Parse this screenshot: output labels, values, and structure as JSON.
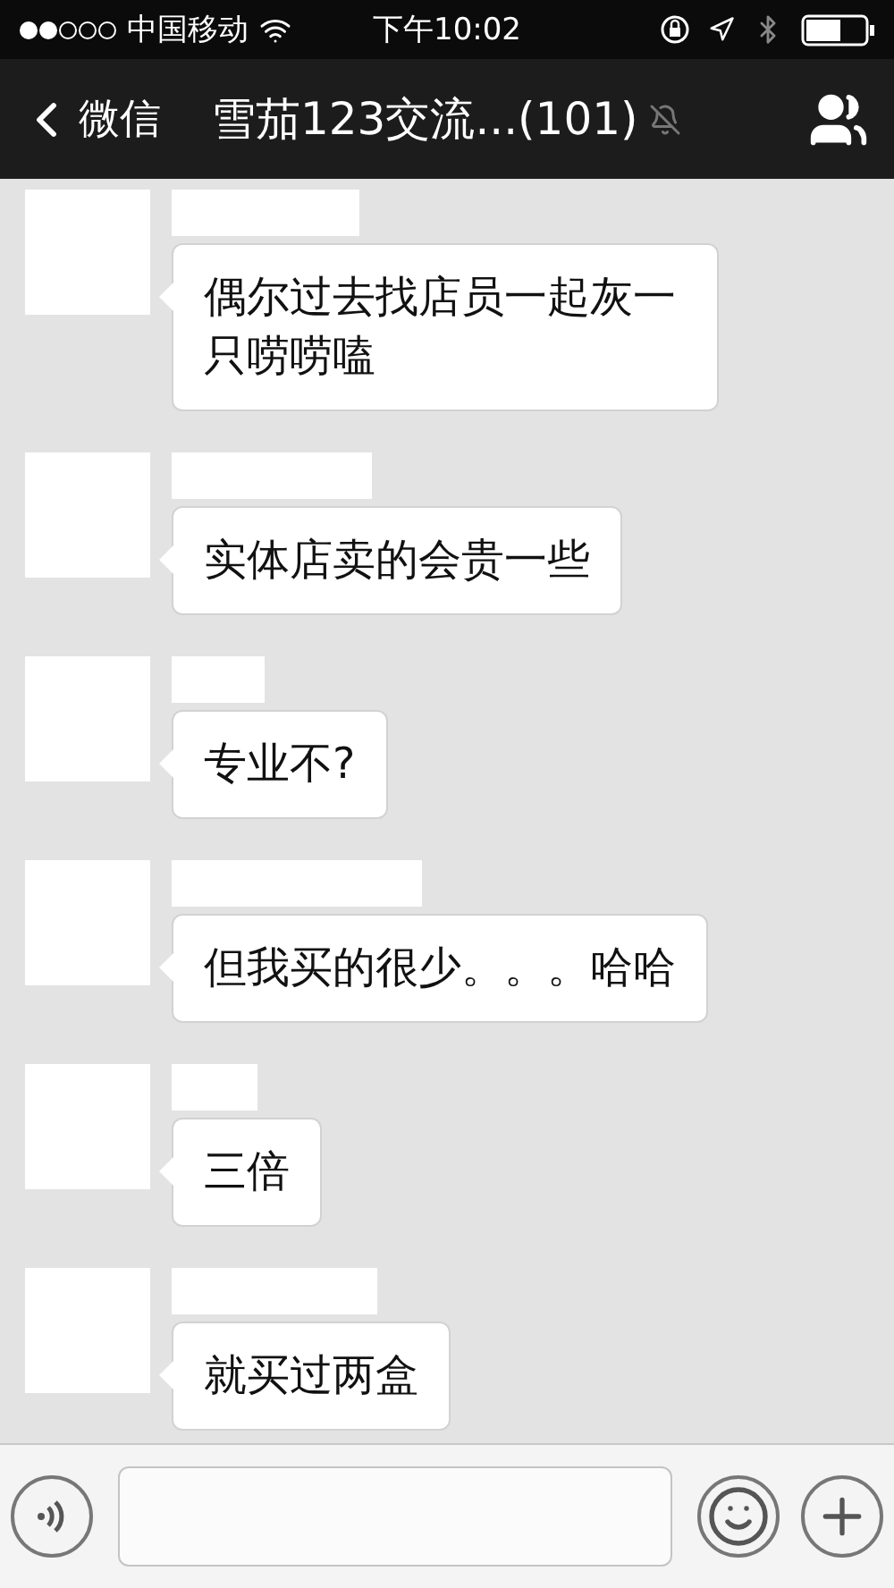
{
  "status_bar": {
    "carrier": "中国移动",
    "time": "下午10:02"
  },
  "nav_bar": {
    "back_label": "微信",
    "title": "雪茄123交流...(101)",
    "muted": true
  },
  "messages": [
    {
      "text": "偶尔过去找店员一起灰一只唠唠嗑"
    },
    {
      "text": "实体店卖的会贵一些"
    },
    {
      "text": "专业不?"
    },
    {
      "text": "但我买的很少。。。哈哈"
    },
    {
      "text": "三倍"
    },
    {
      "text": "就买过两盒"
    }
  ]
}
